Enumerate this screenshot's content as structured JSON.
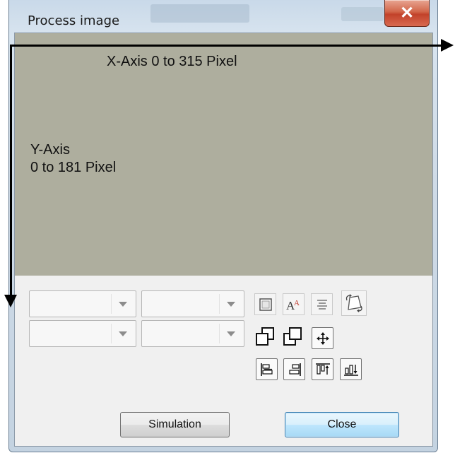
{
  "window": {
    "title": "Process image",
    "close_glyph": "✕"
  },
  "canvas": {
    "background": "#aeae9e",
    "x_axis_label": "X-Axis 0 to 315 Pixel",
    "y_axis_label_line1": "Y-Axis",
    "y_axis_label_line2": "0 to 181 Pixel"
  },
  "toolbar": {
    "combos": [
      {
        "value": ""
      },
      {
        "value": ""
      },
      {
        "value": ""
      },
      {
        "value": ""
      }
    ],
    "icons": [
      "border-icon",
      "font-size-icon",
      "align-center-icon",
      "rotate-icon",
      "bring-to-front-icon",
      "send-to-back-icon",
      "move-icon",
      "align-left-icon",
      "align-right-icon",
      "align-top-icon",
      "align-bottom-icon"
    ]
  },
  "buttons": {
    "simulation_label": "Simulation",
    "close_label": "Close"
  },
  "colors": {
    "accent_close_button": "#bee6fd",
    "close_x_red": "#c2422a"
  }
}
